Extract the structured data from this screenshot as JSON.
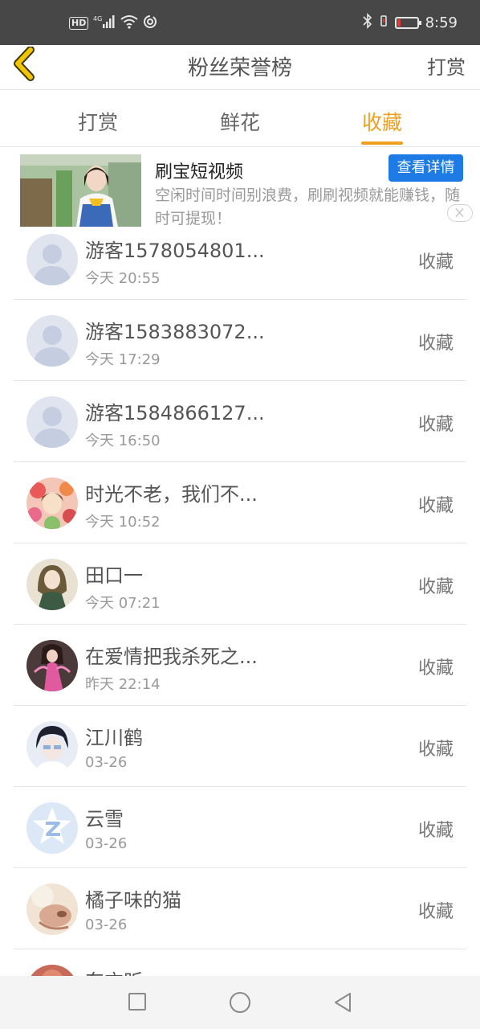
{
  "status_bar": {
    "left_icons": [
      "hd-icon",
      "signal-icon",
      "wifi-icon",
      "sync-icon"
    ],
    "hd": "HD",
    "network": "4G",
    "time": "8:59",
    "battery_color": "#e53935"
  },
  "header": {
    "title": "粉丝荣誉榜",
    "right_action": "打赏",
    "back_icon": "chevron-left-icon",
    "back_icon_color": "#f5c400"
  },
  "tabs": [
    {
      "label": "打赏",
      "active": false
    },
    {
      "label": "鲜花",
      "active": false
    },
    {
      "label": "收藏",
      "active": true
    }
  ],
  "accent_color": "#f0a020",
  "ad": {
    "title": "刷宝短视频",
    "description": "空闲时间时间别浪费，刷刷视频就能赚钱，随时可提现！",
    "button_label": "查看详情",
    "button_color": "#1e7be6"
  },
  "list": [
    {
      "name": "游客1578054801...",
      "time": "今天 20:55",
      "action": "收藏",
      "avatar": "default"
    },
    {
      "name": "游客1583883072...",
      "time": "今天 17:29",
      "action": "收藏",
      "avatar": "default"
    },
    {
      "name": "游客1584866127...",
      "time": "今天 16:50",
      "action": "收藏",
      "avatar": "default"
    },
    {
      "name": "时光不老，我们不...",
      "time": "今天 10:52",
      "action": "收藏",
      "avatar": "flowers"
    },
    {
      "name": "田口一",
      "time": "今天 07:21",
      "action": "收藏",
      "avatar": "girl-green"
    },
    {
      "name": "在爱情把我杀死之...",
      "time": "昨天 22:14",
      "action": "收藏",
      "avatar": "dancer"
    },
    {
      "name": "江川鹤",
      "time": "03-26",
      "action": "收藏",
      "avatar": "boy"
    },
    {
      "name": "云雪",
      "time": "03-26",
      "action": "收藏",
      "avatar": "qq-logo"
    },
    {
      "name": "橘子味的猫",
      "time": "03-26",
      "action": "收藏",
      "avatar": "cat"
    },
    {
      "name": "东方昕",
      "time": "",
      "action": "",
      "avatar": "partial"
    }
  ],
  "navbar": {
    "recent_icon": "square-icon",
    "home_icon": "circle-icon",
    "back_icon": "triangle-back-icon"
  }
}
